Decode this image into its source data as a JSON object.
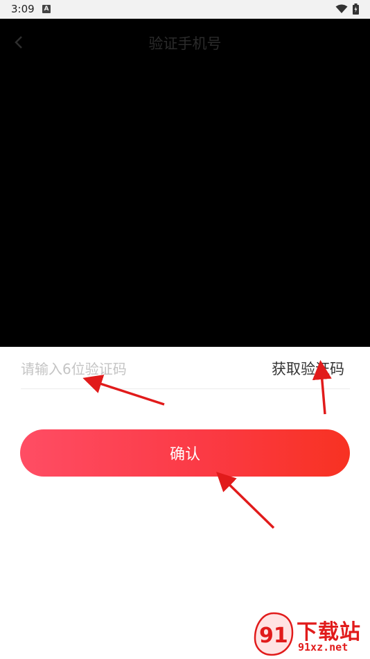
{
  "status_bar": {
    "time": "3:09",
    "notification_icon_letter": "A",
    "wifi_icon": "wifi-icon",
    "battery_icon": "battery-icon"
  },
  "header": {
    "title": "验证手机号",
    "back_icon": "chevron-left-icon"
  },
  "form": {
    "code_input_placeholder": "请输入6位验证码",
    "code_input_value": "",
    "get_code_label": "获取验证码",
    "confirm_label": "确认"
  },
  "colors": {
    "confirm_gradient_start": "#ff4d64",
    "confirm_gradient_end": "#f83222",
    "annotation_arrow": "#e11b1b"
  },
  "watermark": {
    "title": "下载站",
    "url": "91xz.net",
    "logo_text": "91"
  }
}
